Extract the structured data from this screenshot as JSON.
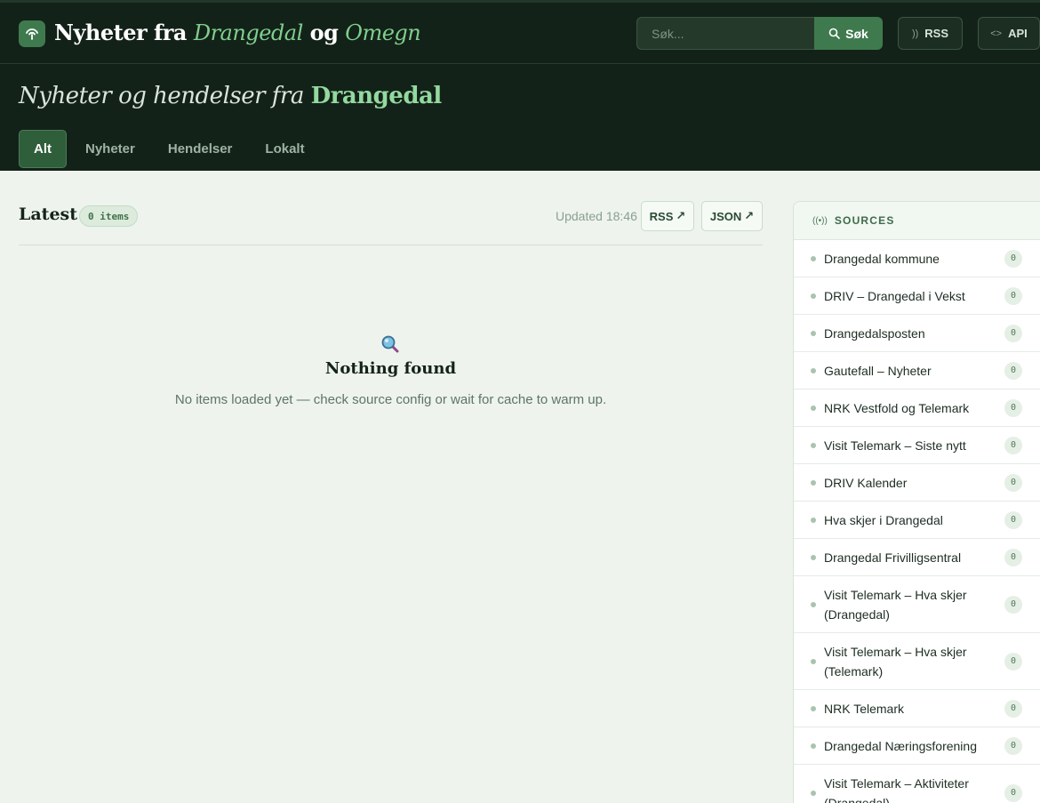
{
  "header": {
    "brand_parts": [
      "Nyheter fra",
      "Drangedal",
      "og",
      "Omegn"
    ],
    "search_placeholder": "Søk...",
    "search_button": "Søk",
    "rss_button": "RSS",
    "api_button": "API",
    "tagline_main": "Nyheter og hendelser fra",
    "tagline_accent": "Drangedal",
    "tabs": [
      "Alt",
      "Nyheter",
      "Hendelser",
      "Lokalt"
    ],
    "active_tab": "Alt"
  },
  "main": {
    "title": "Latest",
    "count_badge": "0 items",
    "updated": "Updated 18:46",
    "rss_link": "RSS",
    "json_link": "JSON",
    "link_arrow": "↗",
    "empty_title": "Nothing found",
    "empty_text": "No items loaded yet — check source config or wait for cache to warm up."
  },
  "sidebar": {
    "title": "SOURCES",
    "items": [
      {
        "label": "Drangedal kommune",
        "count": "0"
      },
      {
        "label": "DRIV – Drangedal i Vekst",
        "count": "0"
      },
      {
        "label": "Drangedalsposten",
        "count": "0"
      },
      {
        "label": "Gautefall – Nyheter",
        "count": "0"
      },
      {
        "label": "NRK Vestfold og Telemark",
        "count": "0"
      },
      {
        "label": "Visit Telemark – Siste nytt",
        "count": "0"
      },
      {
        "label": "DRIV Kalender",
        "count": "0"
      },
      {
        "label": "Hva skjer i Drangedal",
        "count": "0"
      },
      {
        "label": "Drangedal Frivilligsentral",
        "count": "0"
      },
      {
        "label": "Visit Telemark – Hva skjer (Drangedal)",
        "count": "0"
      },
      {
        "label": "Visit Telemark – Hva skjer (Telemark)",
        "count": "0"
      },
      {
        "label": "NRK Telemark",
        "count": "0"
      },
      {
        "label": "Drangedal Næringsforening",
        "count": "0"
      },
      {
        "label": "Visit Telemark – Aktiviteter (Drangedal)",
        "count": "0"
      }
    ]
  },
  "colors": {
    "header_bg": "#132218",
    "accent_green": "#3f7a4e",
    "accent_text": "#7fcf8e",
    "page_bg": "#eef3ee"
  },
  "icons": {
    "logo": "antenna-icon",
    "search": "search-icon",
    "rss": "rss-icon",
    "api": "code-icon",
    "empty": "magnifier-icon",
    "sources": "broadcast-icon"
  }
}
